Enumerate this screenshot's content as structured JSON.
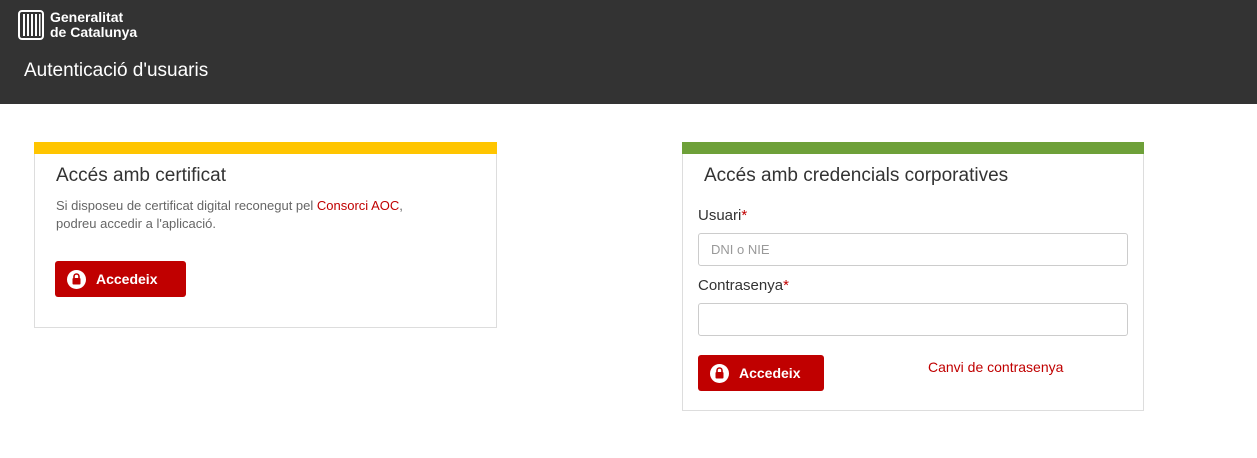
{
  "header": {
    "logo_line1": "Generalitat",
    "logo_line2": "de Catalunya",
    "app_title": "Autenticació d'usuaris",
    "background": "#333333"
  },
  "certificate_panel": {
    "title": "Accés amb certificat",
    "desc_before": "Si disposeu de certificat digital reconegut pel ",
    "desc_link": "Consorci AOC",
    "desc_after": ",",
    "desc_line2": "podreu accedir a l'aplicació.",
    "button_label": "Accedeix",
    "accent_color": "#ffc500"
  },
  "credentials_panel": {
    "title": "Accés amb credencials corporatives",
    "user_label": "Usuari",
    "user_required": "*",
    "user_placeholder": "DNI o NIE",
    "user_value": "",
    "password_label": "Contrasenya",
    "password_required": "*",
    "password_value": "",
    "button_label": "Accedeix",
    "change_password_link": "Canvi de contrasenya",
    "accent_color": "#6ea039"
  },
  "colors": {
    "primary_red": "#c00000"
  },
  "icons": {
    "logo": "generalitat-logo-icon",
    "button": "lock-icon"
  }
}
